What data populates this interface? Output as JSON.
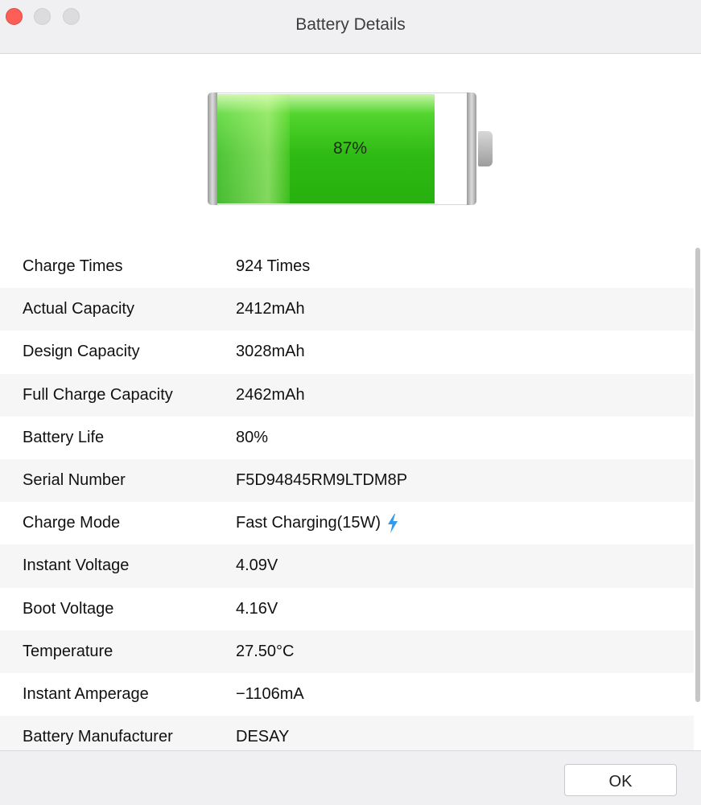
{
  "window": {
    "title": "Battery Details"
  },
  "battery": {
    "percent_label": "87%",
    "level_fraction": 0.87,
    "fill_color": "#2fbb14"
  },
  "details": [
    {
      "label": "Charge Times",
      "value": "924 Times"
    },
    {
      "label": "Actual Capacity",
      "value": "2412mAh"
    },
    {
      "label": "Design Capacity",
      "value": "3028mAh"
    },
    {
      "label": "Full Charge Capacity",
      "value": "2462mAh"
    },
    {
      "label": "Battery Life",
      "value": "80%"
    },
    {
      "label": "Serial Number",
      "value": "F5D94845RM9LTDM8P"
    },
    {
      "label": "Charge Mode",
      "value": "Fast Charging(15W)",
      "icon": "lightning-bolt-icon"
    },
    {
      "label": "Instant Voltage",
      "value": "4.09V"
    },
    {
      "label": "Boot Voltage",
      "value": "4.16V"
    },
    {
      "label": "Temperature",
      "value": "27.50°C"
    },
    {
      "label": "Instant Amperage",
      "value": "−1106mA"
    },
    {
      "label": "Battery Manufacturer",
      "value": "DESAY"
    }
  ],
  "footer": {
    "ok_label": "OK"
  },
  "colors": {
    "close": "#fd5f57",
    "bolt": "#2f9bf0"
  }
}
